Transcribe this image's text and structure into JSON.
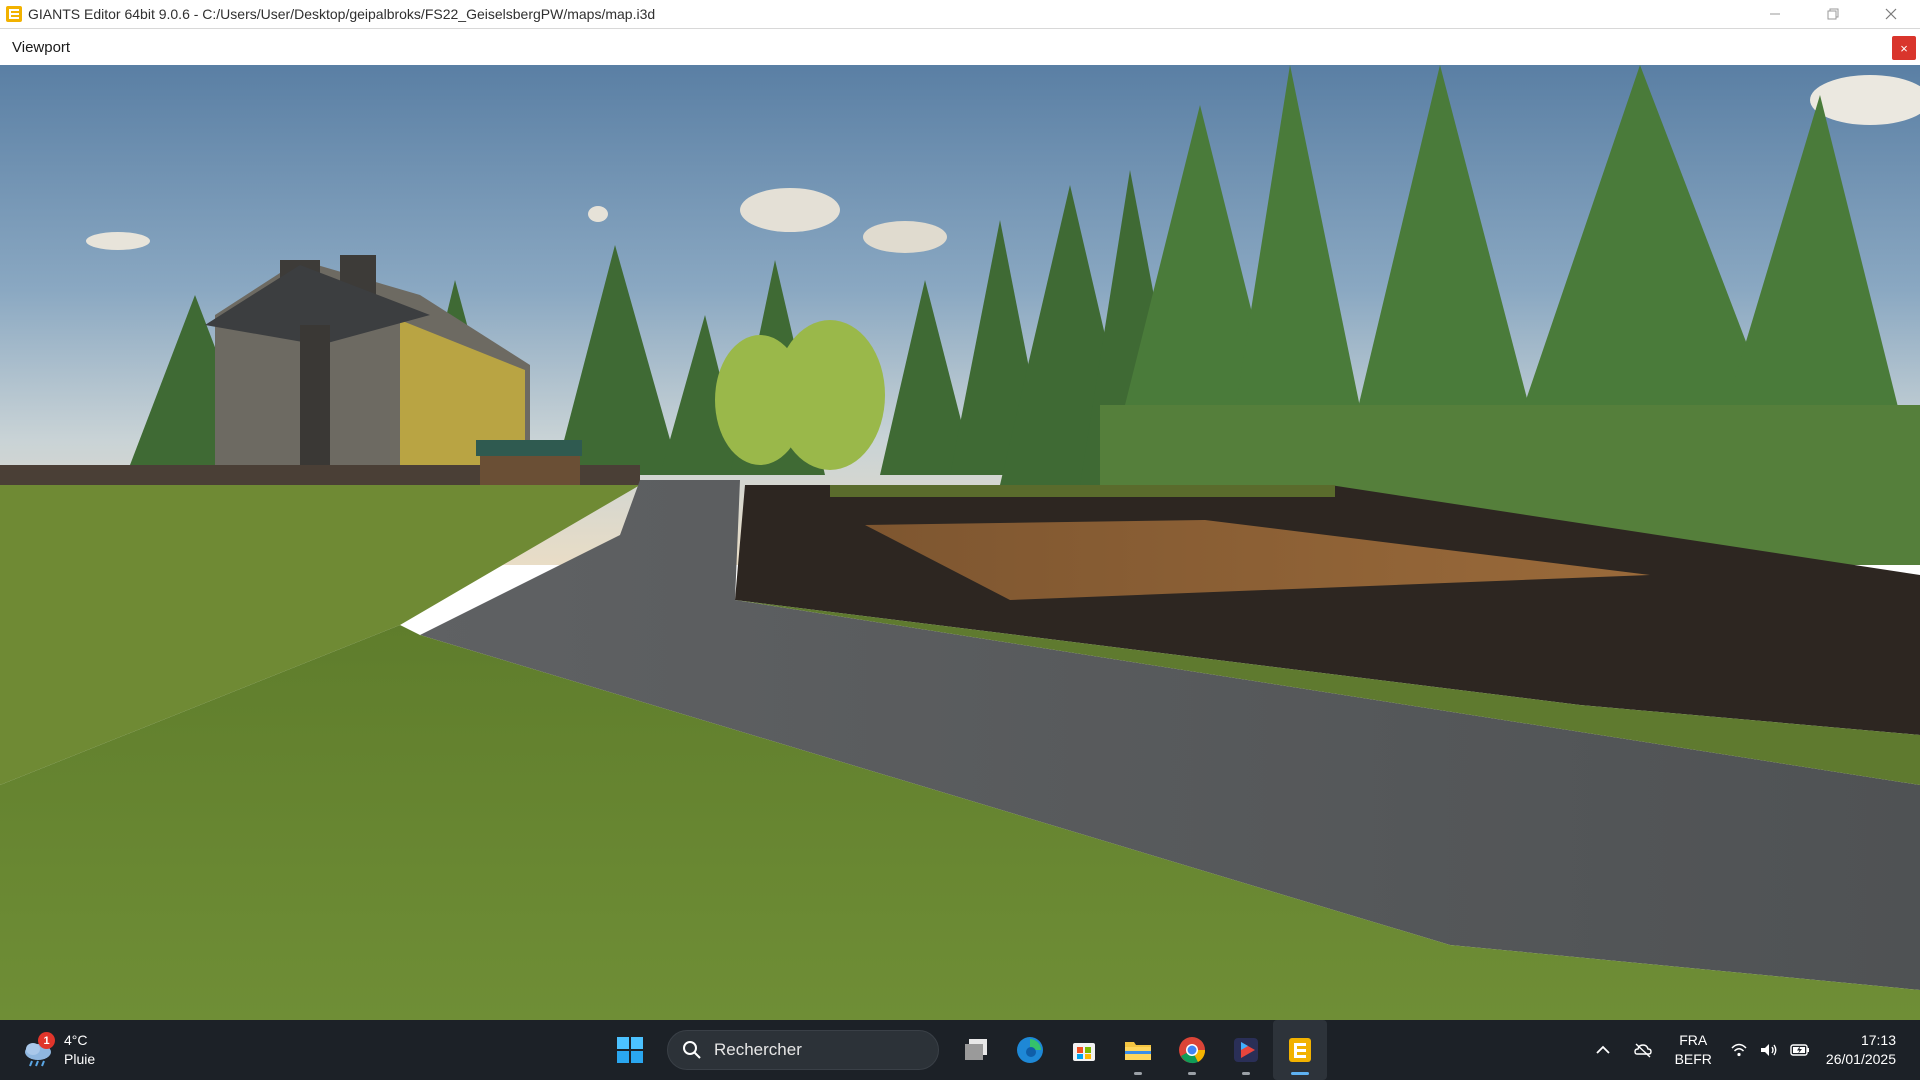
{
  "window": {
    "title": "GIANTS Editor 64bit 9.0.6 - C:/Users/User/Desktop/geipalbroks/FS22_GeiselsbergPW/maps/map.i3d",
    "icon": "giants-editor-icon",
    "controls": [
      "minimize-icon",
      "restore-icon",
      "close-icon"
    ]
  },
  "panel": {
    "title": "Viewport",
    "close_label": "×"
  },
  "colors": {
    "panel_close": "#d9352c",
    "taskbar": "#1c2127",
    "sky_top": "#5d82a6",
    "grass": "#6d8a32",
    "road": "#55585a",
    "field": "#2a241f",
    "soil": "#8a5e31"
  },
  "taskbar": {
    "weather": {
      "badge": "1",
      "temperature": "4°C",
      "condition": "Pluie",
      "icon": "rain-cloud-icon"
    },
    "search": {
      "placeholder": "Rechercher",
      "icon": "search-icon"
    },
    "apps": [
      {
        "name": "start-button",
        "icon": "windows-logo-icon"
      },
      {
        "name": "task-view",
        "icon": "task-view-icon"
      },
      {
        "name": "edge",
        "icon": "edge-icon"
      },
      {
        "name": "store",
        "icon": "store-icon"
      },
      {
        "name": "file-explorer",
        "icon": "folder-icon"
      },
      {
        "name": "chrome",
        "icon": "chrome-icon"
      },
      {
        "name": "media-player",
        "icon": "play-icon"
      },
      {
        "name": "giants-editor",
        "icon": "giants-editor-icon",
        "active": true
      }
    ],
    "tray": {
      "language": "FRA",
      "layout": "BEFR",
      "time": "17:13",
      "date": "26/01/2025"
    }
  }
}
